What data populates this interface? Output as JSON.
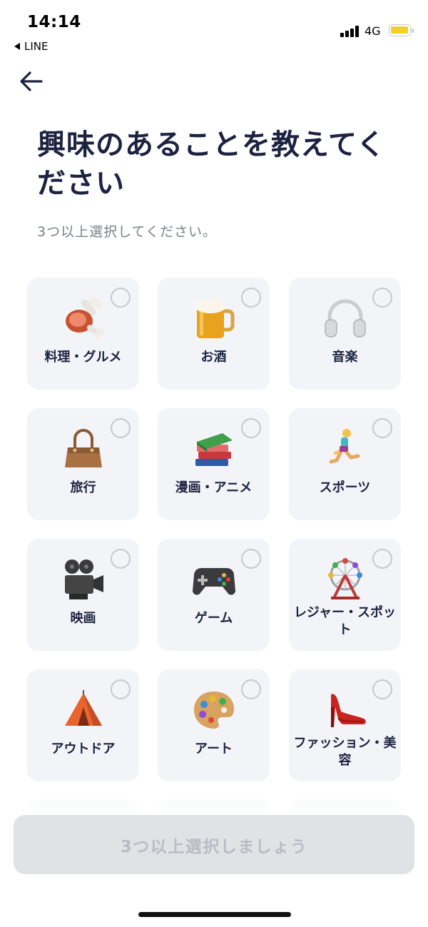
{
  "status_bar": {
    "time": "14:14",
    "back_app": "LINE",
    "network": "4G",
    "battery_color": "#f4cd31"
  },
  "title": "興味のあることを教えてください",
  "subtitle": "3つ以上選択してください。",
  "interests": [
    {
      "label": "料理・グルメ",
      "icon": "meat-on-bone-icon"
    },
    {
      "label": "お酒",
      "icon": "beer-mug-icon"
    },
    {
      "label": "音楽",
      "icon": "headphones-icon"
    },
    {
      "label": "旅行",
      "icon": "handbag-icon"
    },
    {
      "label": "漫画・アニメ",
      "icon": "books-icon"
    },
    {
      "label": "スポーツ",
      "icon": "runner-icon"
    },
    {
      "label": "映画",
      "icon": "movie-camera-icon"
    },
    {
      "label": "ゲーム",
      "icon": "game-controller-icon"
    },
    {
      "label": "レジャー・スポット",
      "icon": "ferris-wheel-icon"
    },
    {
      "label": "アウトドア",
      "icon": "tent-icon"
    },
    {
      "label": "アート",
      "icon": "artist-palette-icon"
    },
    {
      "label": "ファッション・美容",
      "icon": "high-heel-icon"
    }
  ],
  "cta_label": "3つ以上選択しましょう",
  "colors": {
    "title": "#1c2240",
    "tile_bg": "#f3f4f7",
    "cta_bg": "#e1e2e6",
    "cta_text": "#b9bcc4"
  }
}
